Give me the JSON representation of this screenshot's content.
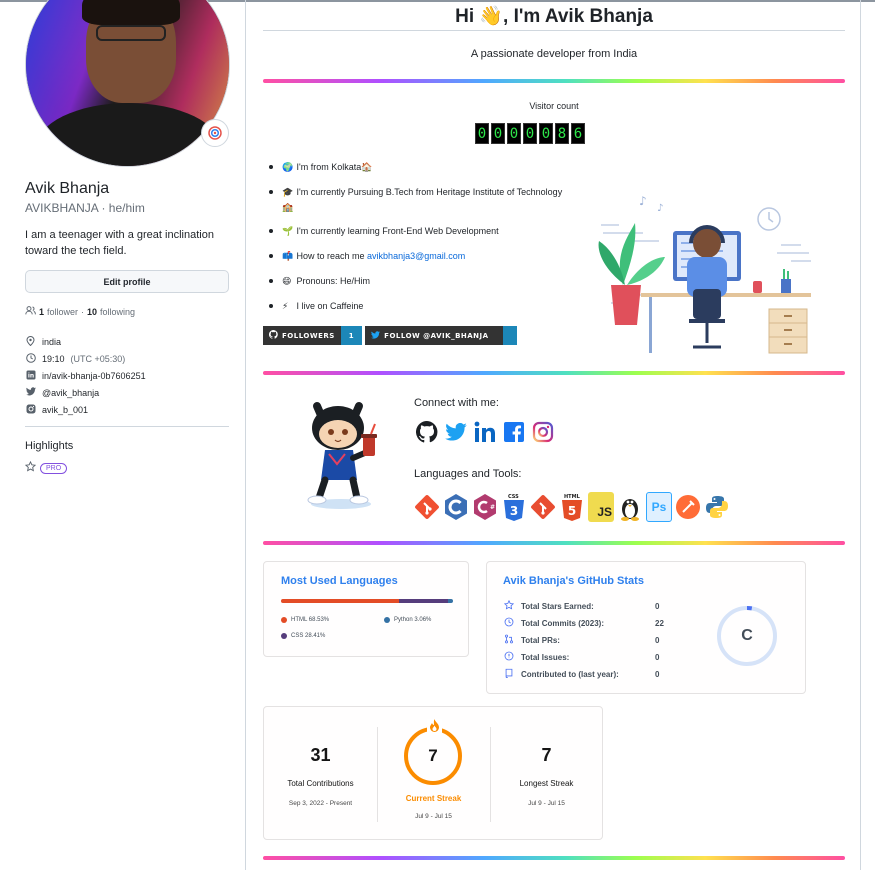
{
  "profile": {
    "name": "Avik Bhanja",
    "login": "AVIKBHANJA",
    "pronouns": "he/him",
    "login_line": "AVIKBHANJA · he/him",
    "bio": "I am a teenager with a great inclination toward the tech field.",
    "edit_label": "Edit profile",
    "followers_count": "1",
    "followers_label": "follower",
    "following_count": "10",
    "following_label": "following",
    "details": [
      {
        "icon": "location-icon",
        "text": "india"
      },
      {
        "icon": "clock-icon",
        "text": "19:10",
        "extra": "(UTC +05:30)"
      },
      {
        "icon": "linkedin-icon",
        "text": "in/avik-bhanja-0b7606251"
      },
      {
        "icon": "twitter-icon",
        "text": "@avik_bhanja"
      },
      {
        "icon": "instagram-icon",
        "text": "avik_b_001"
      }
    ],
    "highlights_title": "Highlights",
    "pro_label": "PRO"
  },
  "readme": {
    "title": "Hi 👋, I'm Avik Bhanja",
    "subtitle": "A passionate developer from India",
    "visitor_label": "Visitor count",
    "visitor_digits": [
      "0",
      "0",
      "0",
      "0",
      "0",
      "8",
      "6"
    ],
    "facts": [
      {
        "emoji": "🌍",
        "text": "I'm from Kolkata🏠"
      },
      {
        "emoji": "🎓",
        "text": "I'm currently Pursuing B.Tech from Heritage Institute of Technology🏫"
      },
      {
        "emoji": "🌱",
        "text": "I'm currently learning Front-End Web Development"
      },
      {
        "emoji": "📫",
        "text": "How to reach me ",
        "link": "avikbhanja3@gmail.com"
      },
      {
        "emoji": "😄",
        "text": "Pronouns: He/Him"
      },
      {
        "emoji": "⚡",
        "text": "I live on Caffeine"
      }
    ],
    "badge_followers_label": "FOLLOWERS",
    "badge_followers_value": "1",
    "badge_twitter_label": "FOLLOW @AVIK_BHANJA",
    "connect_title": "Connect with me:",
    "social_icons": [
      "github-icon",
      "twitter-icon",
      "linkedin-icon",
      "facebook-icon",
      "instagram-icon"
    ],
    "tools_title": "Languages and Tools:",
    "tools": [
      {
        "name": "git-icon",
        "color": "#f05032"
      },
      {
        "name": "c-icon",
        "color": "#3b6fb6"
      },
      {
        "name": "csharp-icon",
        "color": "#b23b6f"
      },
      {
        "name": "css3-icon",
        "color": "#2a6fdb"
      },
      {
        "name": "git-icon",
        "color": "#e84d31"
      },
      {
        "name": "html5-icon",
        "color": "#e44d26"
      },
      {
        "name": "javascript-icon",
        "color": "#f0db4f"
      },
      {
        "name": "linux-icon",
        "color": "#222222"
      },
      {
        "name": "photoshop-icon",
        "color": "#dff0ff"
      },
      {
        "name": "postman-icon",
        "color": "#ff6c37"
      },
      {
        "name": "python-icon",
        "color": "#3776ab"
      }
    ]
  },
  "languages_card": {
    "title": "Most Used Languages",
    "items": [
      {
        "name": "HTML",
        "percent": 68.53,
        "label": "HTML 68.53%",
        "color": "#e34c26"
      },
      {
        "name": "CSS",
        "percent": 28.41,
        "label": "CSS 28.41%",
        "color": "#563d7c"
      },
      {
        "name": "Python",
        "percent": 3.06,
        "label": "Python 3.06%",
        "color": "#3572a5"
      }
    ]
  },
  "stats_card": {
    "title": "Avik Bhanja's GitHub Stats",
    "rows": [
      {
        "icon": "star-icon",
        "label": "Total Stars Earned:",
        "value": "0"
      },
      {
        "icon": "history-icon",
        "label": "Total Commits (2023):",
        "value": "22"
      },
      {
        "icon": "pr-icon",
        "label": "Total PRs:",
        "value": "0"
      },
      {
        "icon": "issue-icon",
        "label": "Total Issues:",
        "value": "0"
      },
      {
        "icon": "repo-icon",
        "label": "Contributed to (last year):",
        "value": "0"
      }
    ],
    "rank": "C"
  },
  "streak_card": {
    "total_value": "31",
    "total_label": "Total Contributions",
    "total_range": "Sep 3, 2022 - Present",
    "current_value": "7",
    "current_label": "Current Streak",
    "current_range": "Jul 9 - Jul 15",
    "longest_value": "7",
    "longest_label": "Longest Streak",
    "longest_range": "Jul 9 - Jul 15",
    "accent": "#fb8c00"
  }
}
